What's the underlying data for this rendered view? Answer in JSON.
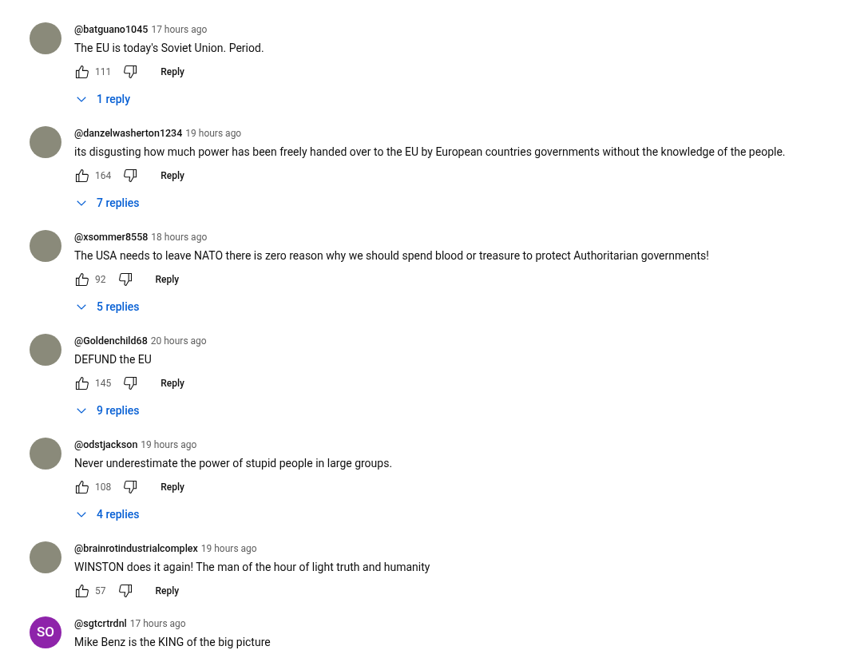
{
  "comments": [
    {
      "avatar": {
        "kind": "photo"
      },
      "author": "@batguano1045",
      "time": "17 hours ago",
      "text": "The EU is today's Soviet Union. Period.",
      "likes": "111",
      "reply_label": "Reply",
      "replies": "1 reply"
    },
    {
      "avatar": {
        "kind": "photo"
      },
      "author": "@danzelwasherton1234",
      "time": "19 hours ago",
      "text": "its disgusting how much power has been freely handed over to the EU by European countries governments without the knowledge of the people.",
      "likes": "164",
      "reply_label": "Reply",
      "replies": "7 replies"
    },
    {
      "avatar": {
        "kind": "photo"
      },
      "author": "@xsommer8558",
      "time": "18 hours ago",
      "text": "The USA needs to leave NATO there is zero reason why we should spend blood or treasure to protect Authoritarian governments!",
      "likes": "92",
      "reply_label": "Reply",
      "replies": "5 replies"
    },
    {
      "avatar": {
        "kind": "photo"
      },
      "author": "@Goldenchild68",
      "time": "20 hours ago",
      "text": "DEFUND the EU",
      "likes": "145",
      "reply_label": "Reply",
      "replies": "9 replies"
    },
    {
      "avatar": {
        "kind": "photo"
      },
      "author": "@odstjackson",
      "time": "19 hours ago",
      "text": "Never underestimate the power of stupid people in large groups.",
      "likes": "108",
      "reply_label": "Reply",
      "replies": "4 replies"
    },
    {
      "avatar": {
        "kind": "photo"
      },
      "author": "@brainrotindustrialcomplex",
      "time": "19 hours ago",
      "text": "WINSTON does it again! The man of the hour of light truth and humanity",
      "likes": "57",
      "reply_label": "Reply"
    },
    {
      "avatar": {
        "kind": "initials",
        "initials": "SO",
        "color": "#8e24aa"
      },
      "author": "@sgtcrtrdnl",
      "time": "17 hours ago",
      "text": "Mike Benz is the KING of the big picture"
    }
  ]
}
